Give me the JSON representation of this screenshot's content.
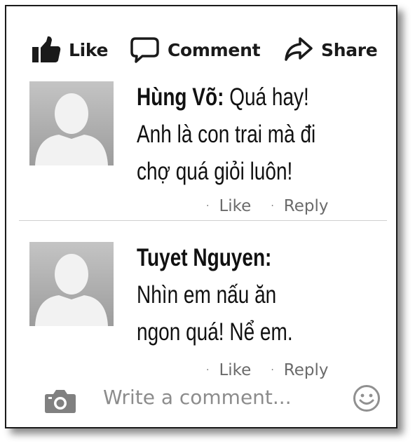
{
  "actions": {
    "like_label": "Like",
    "comment_label": "Comment",
    "share_label": "Share"
  },
  "comments": [
    {
      "author": "Hùng Võ:",
      "text_first": " Quá hay!",
      "text_lines": [
        "Anh là con trai mà đi",
        "chợ quá giỏi luôn!"
      ],
      "like_label": "Like",
      "reply_label": "Reply"
    },
    {
      "author": "Tuyet Nguyen:",
      "text_lines": [
        "Nhìn em nấu ăn",
        "ngon quá! Nể em."
      ],
      "like_label": "Like",
      "reply_label": "Reply"
    }
  ],
  "composer": {
    "placeholder": "Write a comment...",
    "icons": [
      "camera-icon",
      "smiley-icon"
    ]
  },
  "colors": {
    "avatar_bg": "#a9a9a9",
    "avatar_silhouette": "#f2f2f2",
    "meta_text": "#6b6b6b",
    "placeholder_text": "#8c8c8c"
  }
}
